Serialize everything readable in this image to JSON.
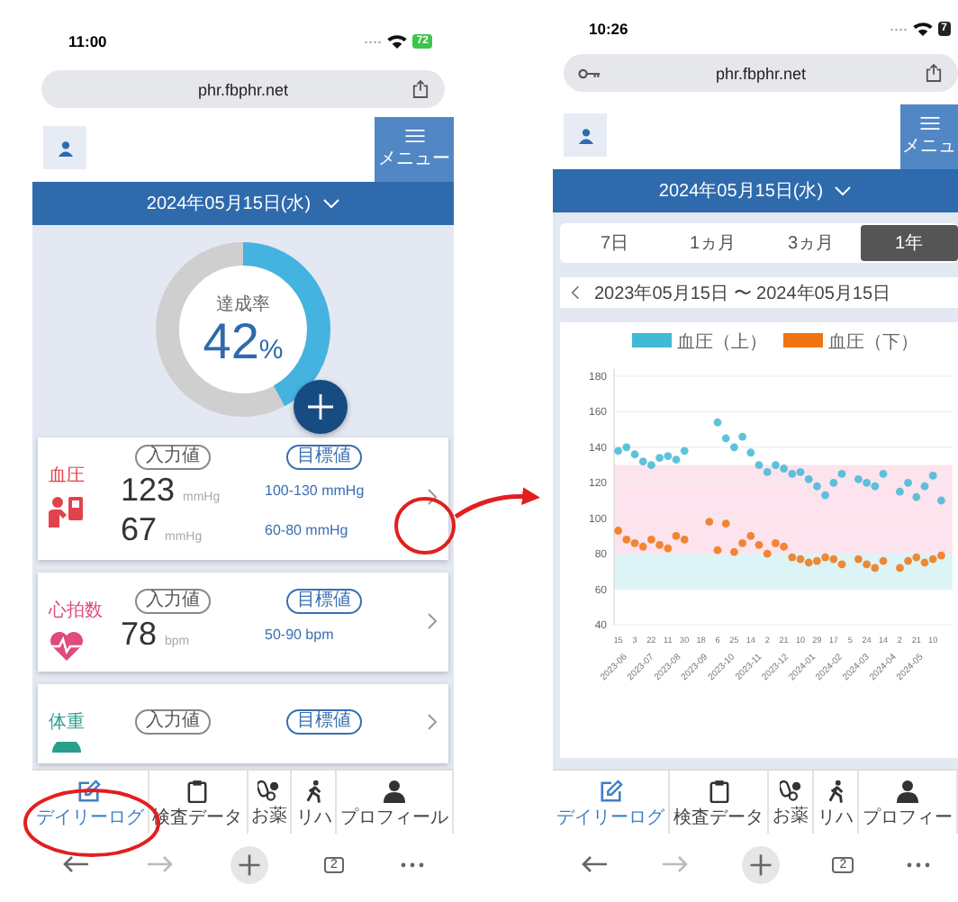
{
  "left_screen": {
    "status_bar": {
      "time": "11:00",
      "battery": "72",
      "charging": true
    },
    "address_bar": {
      "url": "phr.fbphr.net"
    },
    "header": {
      "menu_label": "メニュー"
    },
    "date": "2024年05月15日(水)",
    "achievement": {
      "label": "達成率",
      "value": "42",
      "unit": "%",
      "level": 0.42
    },
    "cards": [
      {
        "title": "血圧",
        "kind": "blood-pressure",
        "color": "#e2424c",
        "input_badge": "入力値",
        "target_badge": "目標値",
        "readings": [
          {
            "value": "123",
            "unit": "mmHg",
            "target": "100-130 mmHg"
          },
          {
            "value": "67",
            "unit": "mmHg",
            "target": "60-80 mmHg"
          }
        ]
      },
      {
        "title": "心拍数",
        "kind": "heart",
        "color": "#e04a7c",
        "input_badge": "入力値",
        "target_badge": "目標値",
        "readings": [
          {
            "value": "78",
            "unit": "bpm",
            "target": "50-90 bpm"
          }
        ]
      },
      {
        "title": "体重",
        "kind": "scale",
        "color": "#2aa08c",
        "input_badge": "入力値",
        "target_badge": "目標値"
      }
    ],
    "nav": [
      {
        "kind": "edit",
        "label": "デイリーログ",
        "selected": true
      },
      {
        "kind": "clipboard",
        "label": "検査データ",
        "selected": false
      },
      {
        "kind": "pills",
        "label": "お薬",
        "selected": false
      },
      {
        "kind": "walker",
        "label": "リハ",
        "selected": false
      },
      {
        "kind": "person",
        "label": "プロフィール",
        "selected": false
      }
    ],
    "toolbar": {
      "tab_count": "2"
    }
  },
  "right_screen": {
    "status_bar": {
      "time": "10:26",
      "battery": "7",
      "charging": false
    },
    "address_bar": {
      "url": "phr.fbphr.net",
      "key_icon": true
    },
    "header": {
      "menu_label": "メニュ"
    },
    "date": "2024年05月15日(水)",
    "periods": [
      {
        "label": "7日",
        "selected": false
      },
      {
        "label": "1ヵ月",
        "selected": false
      },
      {
        "label": "3ヵ月",
        "selected": false
      },
      {
        "label": "1年",
        "selected": true
      }
    ],
    "range": "2023年05月15日 〜 2024年05月15日",
    "chart": {
      "chart_data": {
        "type": "scatter",
        "categories": [
          "15",
          null,
          "3",
          null,
          "22",
          null,
          "11",
          null,
          "30",
          null,
          "18",
          null,
          "6",
          null,
          "25",
          null,
          "14",
          null,
          "2",
          null,
          "21",
          null,
          "10",
          null,
          "29",
          null,
          "17",
          null,
          "5",
          null,
          "24",
          null,
          "14",
          null,
          "2",
          null,
          "21",
          null,
          "10",
          null
        ],
        "series": [
          {
            "name": "血圧（上）",
            "color": "#41b8d5",
            "values": [
              138,
              140,
              136,
              132,
              130,
              134,
              135,
              133,
              138,
              null,
              null,
              null,
              154,
              145,
              140,
              146,
              137,
              130,
              126,
              130,
              128,
              125,
              126,
              122,
              118,
              113,
              120,
              125,
              null,
              122,
              120,
              118,
              125,
              null,
              115,
              120,
              112,
              118,
              124,
              110
            ]
          },
          {
            "name": "血圧（下）",
            "color": "#f07412",
            "values": [
              93,
              88,
              86,
              84,
              88,
              85,
              83,
              90,
              88,
              null,
              null,
              98,
              82,
              97,
              81,
              86,
              90,
              85,
              80,
              86,
              84,
              78,
              77,
              75,
              76,
              78,
              77,
              74,
              null,
              77,
              74,
              72,
              76,
              null,
              72,
              76,
              78,
              75,
              77,
              79
            ]
          }
        ],
        "grid": true,
        "legend": true,
        "ylim": [
          40,
          180
        ],
        "yticks": [
          40,
          60,
          80,
          100,
          120,
          140,
          160,
          180
        ],
        "bands": [
          {
            "axis": "y",
            "from": 80,
            "to": 130,
            "color": "#fde3ee"
          },
          {
            "axis": "y",
            "from": 60,
            "to": 80,
            "color": "#dcf4f6"
          }
        ]
      },
      "month_labels": [
        "2023-06",
        "2023-07",
        "2023-08",
        "2023-09",
        "2023-10",
        "2023-11",
        "2023-12",
        "2024-01",
        "2024-02",
        "2024-03",
        "2024-04",
        "2024-05"
      ]
    },
    "nav": [
      {
        "kind": "edit",
        "label": "デイリーログ",
        "selected": true
      },
      {
        "kind": "clipboard",
        "label": "検査データ",
        "selected": false
      },
      {
        "kind": "pills",
        "label": "お薬",
        "selected": false
      },
      {
        "kind": "walker",
        "label": "リハ",
        "selected": false
      },
      {
        "kind": "person",
        "label": "プロフィー",
        "selected": false
      }
    ],
    "toolbar": {
      "tab_count": "2"
    }
  }
}
